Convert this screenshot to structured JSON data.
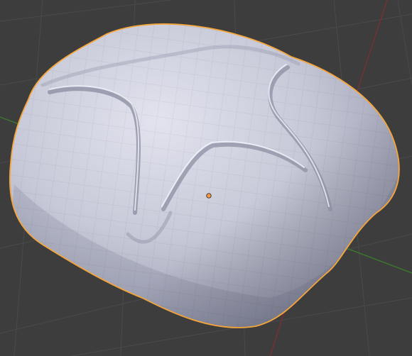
{
  "viewport": {
    "type": "3d-viewport",
    "object": "subdivided-rounded-mesh",
    "selected": true,
    "shading": "solid",
    "show_grid": true
  },
  "colors": {
    "background": "#3d3d3d",
    "grid_line": "#4a4a4a",
    "x_axis": "#7a3030",
    "y_axis": "#3c7a2c",
    "selection_outline": "#f5a53a",
    "mesh_light": "#d6d8e6",
    "mesh_mid": "#a9abbe",
    "mesh_dark": "#7b7d91",
    "origin_dot": "#f59a4a"
  },
  "icons": [
    "object-origin-icon"
  ]
}
